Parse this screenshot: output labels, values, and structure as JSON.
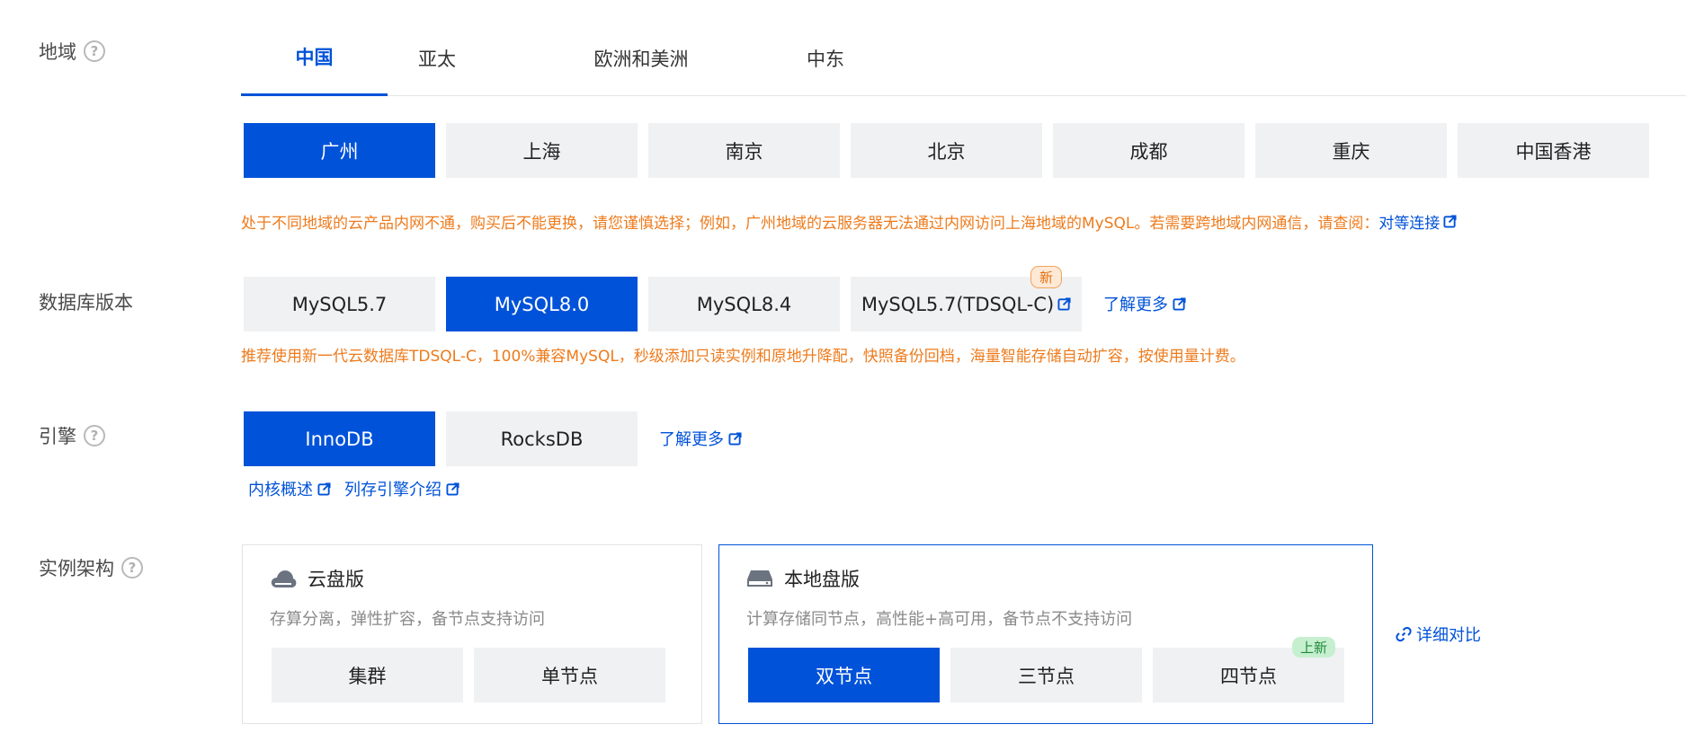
{
  "region": {
    "label": "地域",
    "tabs": [
      "中国",
      "亚太",
      "欧洲和美洲",
      "中东"
    ],
    "active_tab": "中国",
    "cities": [
      "广州",
      "上海",
      "南京",
      "北京",
      "成都",
      "重庆",
      "中国香港"
    ],
    "selected_city": "广州",
    "note": "处于不同地域的云产品内网不通，购买后不能更换，请您谨慎选择；例如，广州地域的云服务器无法通过内网访问上海地域的MySQL。若需要跨地域内网通信，请查阅：",
    "note_link": "对等连接"
  },
  "db_version": {
    "label": "数据库版本",
    "options": [
      "MySQL5.7",
      "MySQL8.0",
      "MySQL8.4",
      "MySQL5.7(TDSQL-C)"
    ],
    "selected": "MySQL8.0",
    "new_badge": "新",
    "learn_more": "了解更多",
    "note": "推荐使用新一代云数据库TDSQL-C，100%兼容MySQL，秒级添加只读实例和原地升降配，快照备份回档，海量智能存储自动扩容，按使用量计费。"
  },
  "engine": {
    "label": "引擎",
    "options": [
      "InnoDB",
      "RocksDB"
    ],
    "selected": "InnoDB",
    "learn_more": "了解更多",
    "links": [
      "内核概述",
      "列存引擎介绍"
    ]
  },
  "architecture": {
    "label": "实例架构",
    "cloud": {
      "title": "云盘版",
      "desc": "存算分离，弹性扩容，备节点支持访问",
      "options": [
        "集群",
        "单节点"
      ]
    },
    "local": {
      "title": "本地盘版",
      "desc": "计算存储同节点，高性能+高可用，备节点不支持访问",
      "options": [
        "双节点",
        "三节点",
        "四节点"
      ],
      "selected": "双节点",
      "new_badge": "上新"
    },
    "compare_link": "详细对比"
  },
  "colors": {
    "primary": "#0052d9",
    "warning": "#ee7b1c",
    "button_bg": "#f0f1f3"
  }
}
